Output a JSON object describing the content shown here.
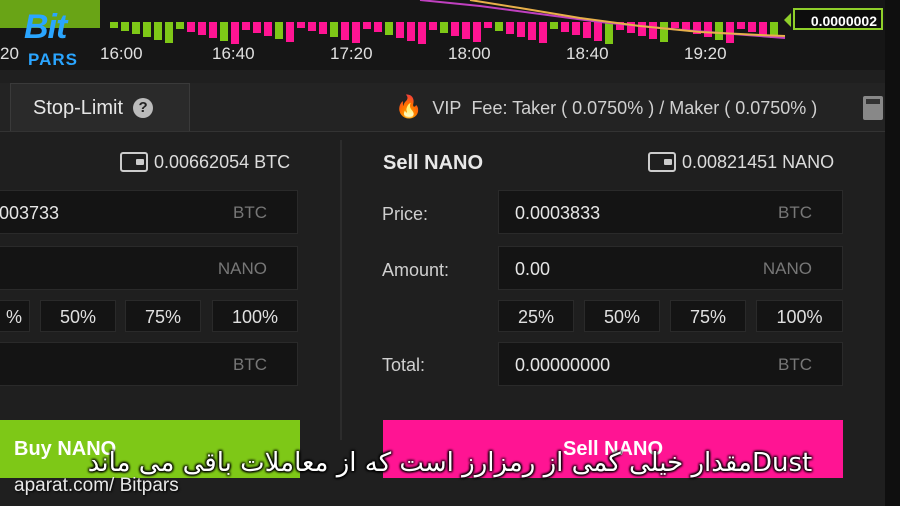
{
  "logo": {
    "big": "Bit",
    "small": "PARS"
  },
  "chart": {
    "time_labels": [
      "20",
      "16:00",
      "16:40",
      "17:20",
      "18:00",
      "18:40",
      "19:20"
    ],
    "current_price": "0.0000002"
  },
  "tabs": {
    "stop_limit": "Stop-Limit",
    "help": "?"
  },
  "fee": {
    "vip": "VIP",
    "text": "Fee: Taker ( 0.0750% ) / Maker ( 0.0750% )"
  },
  "buy": {
    "balance": "0.00662054 BTC",
    "price_value": "003733",
    "price_unit": "BTC",
    "amount_unit": "NANO",
    "pcts": [
      "%",
      "50%",
      "75%",
      "100%"
    ],
    "total_unit": "BTC",
    "button": "Buy NANO"
  },
  "sell": {
    "title": "Sell NANO",
    "balance": "0.00821451 NANO",
    "price_label": "Price:",
    "price_value": "0.0003833",
    "price_unit": "BTC",
    "amount_label": "Amount:",
    "amount_value": "0.00",
    "amount_unit": "NANO",
    "pcts": [
      "25%",
      "50%",
      "75%",
      "100%"
    ],
    "total_label": "Total:",
    "total_value": "0.00000000",
    "total_unit": "BTC",
    "button": "Sell NANO"
  },
  "subtitle": "Dustمقدار خیلی کمی از رمزارز است که از معاملات باقی می ماند",
  "watermark": "aparat.com/ Bitpars",
  "colors": {
    "buy": "#7ec817",
    "sell": "#ff1493",
    "accent": "#2aa5ff"
  }
}
